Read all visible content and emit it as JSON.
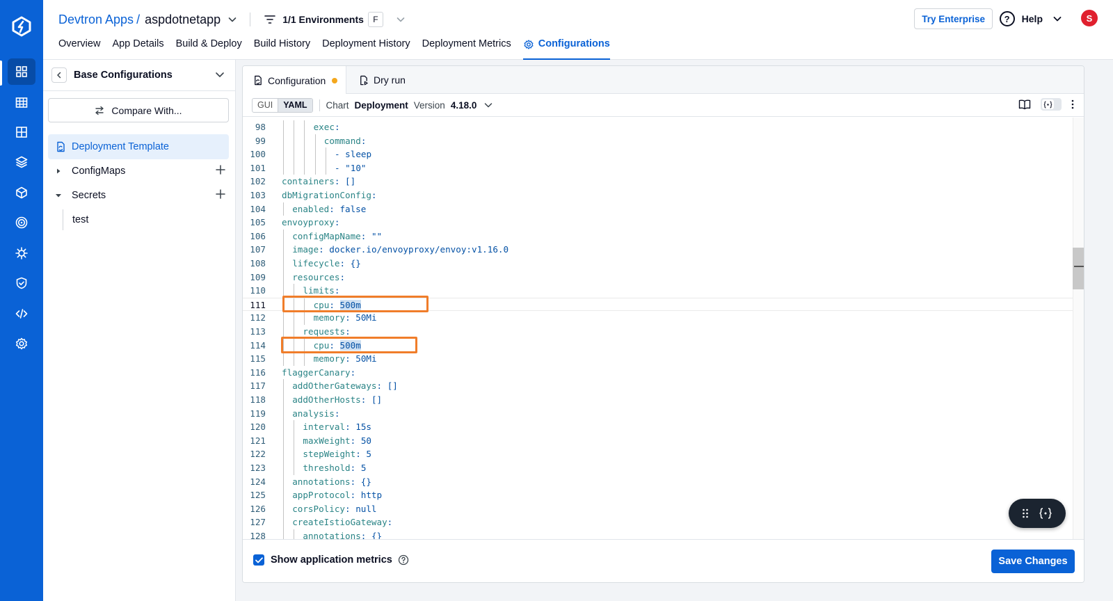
{
  "breadcrumb": {
    "parent": "Devtron Apps",
    "separator": "/",
    "app_name": "aspdotnetapp",
    "environments": "1/1 Environments",
    "env_filter_badge": "F"
  },
  "header": {
    "try_enterprise": "Try Enterprise",
    "help": "Help",
    "help_glyph": "?",
    "avatar_initial": "S",
    "avatar_color": "#e0202e"
  },
  "tabs": [
    {
      "label": "Overview",
      "active": false
    },
    {
      "label": "App Details",
      "active": false
    },
    {
      "label": "Build & Deploy",
      "active": false
    },
    {
      "label": "Build History",
      "active": false
    },
    {
      "label": "Deployment History",
      "active": false
    },
    {
      "label": "Deployment Metrics",
      "active": false
    },
    {
      "label": "Configurations",
      "active": true
    }
  ],
  "sidebar": {
    "title": "Base Configurations",
    "compare_button": "Compare With...",
    "deployment_template": "Deployment Template",
    "configmaps": "ConfigMaps",
    "secrets": "Secrets",
    "secret_items": [
      "test"
    ]
  },
  "panel": {
    "tab_configuration": "Configuration",
    "tab_dry_run": "Dry run",
    "unsaved_dot_color": "#f4a71d",
    "mode_gui": "GUI",
    "mode_yaml": "YAML",
    "active_mode": "YAML",
    "chart_label": "Chart",
    "chart_name": "Deployment",
    "version_label": "Version",
    "version_value": "4.18.0",
    "show_metrics_label": "Show application metrics",
    "show_metrics_checked": true,
    "save_button": "Save Changes"
  },
  "editor": {
    "current_line": 111,
    "lines": [
      {
        "n": "98",
        "indent": 3,
        "key": "exec",
        "sep": ":",
        "val": ""
      },
      {
        "n": "99",
        "indent": 4,
        "key": "command",
        "sep": ":",
        "val": ""
      },
      {
        "n": "100",
        "indent": 5,
        "key": "",
        "sep": "- ",
        "val": "sleep"
      },
      {
        "n": "101",
        "indent": 5,
        "key": "",
        "sep": "- ",
        "val": "\"10\""
      },
      {
        "n": "102",
        "indent": 0,
        "key": "containers",
        "sep": ": ",
        "val": "[]"
      },
      {
        "n": "103",
        "indent": 0,
        "key": "dbMigrationConfig",
        "sep": ":",
        "val": ""
      },
      {
        "n": "104",
        "indent": 1,
        "key": "enabled",
        "sep": ": ",
        "val": "false"
      },
      {
        "n": "105",
        "indent": 0,
        "key": "envoyproxy",
        "sep": ":",
        "val": ""
      },
      {
        "n": "106",
        "indent": 1,
        "key": "configMapName",
        "sep": ": ",
        "val": "\"\""
      },
      {
        "n": "107",
        "indent": 1,
        "key": "image",
        "sep": ": ",
        "val": "docker.io/envoyproxy/envoy:v1.16.0"
      },
      {
        "n": "108",
        "indent": 1,
        "key": "lifecycle",
        "sep": ": ",
        "val": "{}"
      },
      {
        "n": "109",
        "indent": 1,
        "key": "resources",
        "sep": ":",
        "val": ""
      },
      {
        "n": "110",
        "indent": 2,
        "key": "limits",
        "sep": ":",
        "val": ""
      },
      {
        "n": "111",
        "indent": 3,
        "key": "cpu",
        "sep": ": ",
        "val": "500m",
        "selected": true
      },
      {
        "n": "112",
        "indent": 3,
        "key": "memory",
        "sep": ": ",
        "val": "50Mi"
      },
      {
        "n": "113",
        "indent": 2,
        "key": "requests",
        "sep": ":",
        "val": ""
      },
      {
        "n": "114",
        "indent": 3,
        "key": "cpu",
        "sep": ": ",
        "val": "500m",
        "selected": true
      },
      {
        "n": "115",
        "indent": 3,
        "key": "memory",
        "sep": ": ",
        "val": "50Mi"
      },
      {
        "n": "116",
        "indent": 0,
        "key": "flaggerCanary",
        "sep": ":",
        "val": ""
      },
      {
        "n": "117",
        "indent": 1,
        "key": "addOtherGateways",
        "sep": ": ",
        "val": "[]"
      },
      {
        "n": "118",
        "indent": 1,
        "key": "addOtherHosts",
        "sep": ": ",
        "val": "[]"
      },
      {
        "n": "119",
        "indent": 1,
        "key": "analysis",
        "sep": ":",
        "val": ""
      },
      {
        "n": "120",
        "indent": 2,
        "key": "interval",
        "sep": ": ",
        "val": "15s"
      },
      {
        "n": "121",
        "indent": 2,
        "key": "maxWeight",
        "sep": ": ",
        "val": "50"
      },
      {
        "n": "122",
        "indent": 2,
        "key": "stepWeight",
        "sep": ": ",
        "val": "5"
      },
      {
        "n": "123",
        "indent": 2,
        "key": "threshold",
        "sep": ": ",
        "val": "5"
      },
      {
        "n": "124",
        "indent": 1,
        "key": "annotations",
        "sep": ": ",
        "val": "{}"
      },
      {
        "n": "125",
        "indent": 1,
        "key": "appProtocol",
        "sep": ": ",
        "val": "http"
      },
      {
        "n": "126",
        "indent": 1,
        "key": "corsPolicy",
        "sep": ": ",
        "val": "null"
      },
      {
        "n": "127",
        "indent": 1,
        "key": "createIstioGateway",
        "sep": ":",
        "val": ""
      },
      {
        "n": "128",
        "indent": 2,
        "key": "annotations",
        "sep": ": ",
        "val": "{}"
      }
    ]
  },
  "colors": {
    "brand_blue": "#0a62d6",
    "highlight_box": "#f07d2a",
    "yaml_key": "#2a8486",
    "yaml_value": "#0451a5"
  },
  "icons": {
    "rail": [
      "devtron-logo-icon",
      "applications-icon",
      "app-groups-icon",
      "chart-store-icon",
      "resource-browser-icon",
      "infrastructure-icon",
      "deployment-window-icon",
      "bulk-edit-icon",
      "security-icon",
      "code-icon",
      "global-configurations-icon"
    ]
  }
}
